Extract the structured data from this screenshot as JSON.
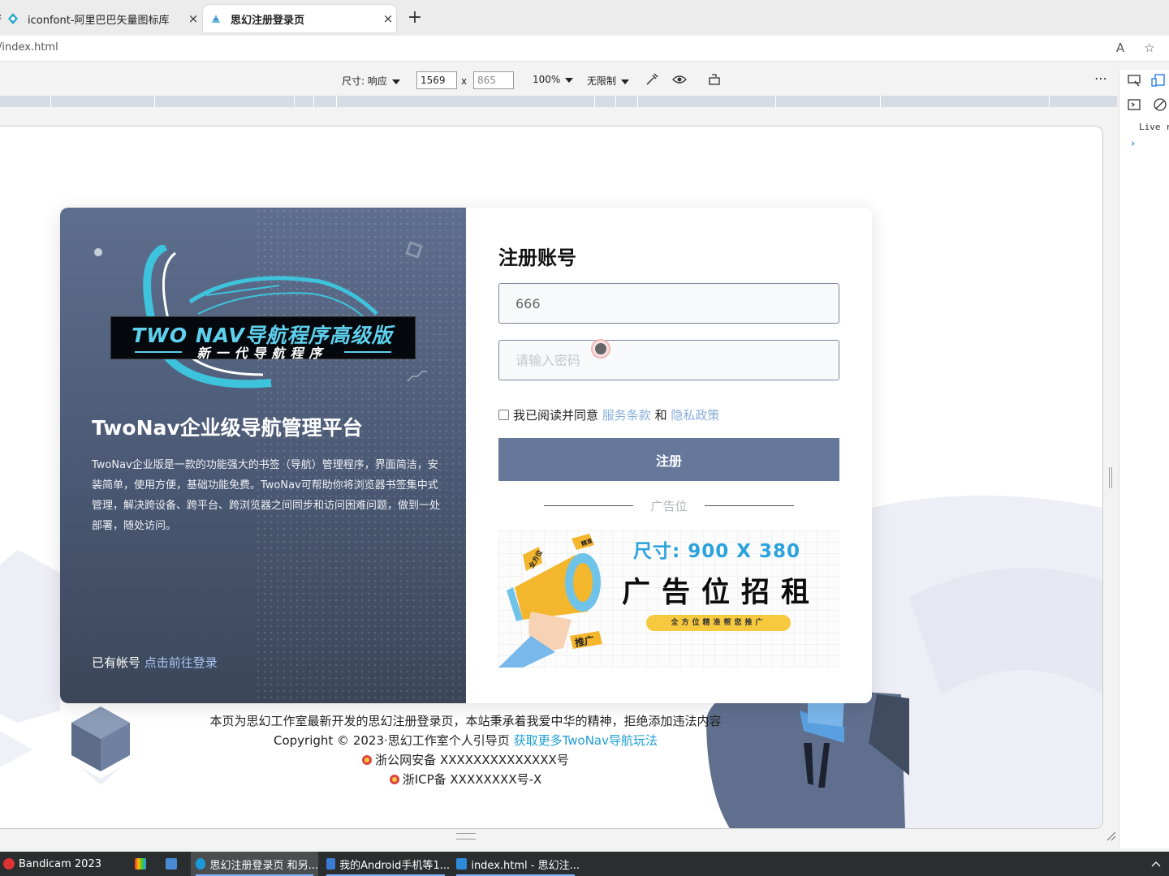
{
  "browser": {
    "tabs": [
      {
        "title": "iconfont-阿里巴巴矢量图标库",
        "icon": "iconfont-icon"
      },
      {
        "title": "思幻注册登录页",
        "icon": "page-icon"
      }
    ],
    "new_tab_label": "+",
    "close_label": "×",
    "url": "/index.html",
    "read_aloud_icon": "Aͅ",
    "favorite_icon": "☆"
  },
  "devtools": {
    "size_label": "尺寸: 响应",
    "width_value": "1569",
    "times": "x",
    "height_placeholder": "865",
    "zoom": "100%",
    "throttle": "无限制",
    "more": "⋯",
    "live_text": "Live r",
    "chevron": "›"
  },
  "page": {
    "logo": {
      "title": "TWO NAV导航程序高级版",
      "subtitle": "新一代导航程序"
    },
    "platform_title": "TwoNav企业级导航管理平台",
    "description": "TwoNav企业版是一款的功能强大的书签（导航）管理程序，界面简洁，安装简单，使用方便，基础功能免费。TwoNav可帮助你将浏览器书签集中式管理，解决跨设备、跨平台、跨浏览器之间同步和访问困难问题，做到一处部署，随处访问。",
    "have_account": "已有帐号",
    "login_link": "点击前往登录",
    "register_title": "注册账号",
    "username_value": "666",
    "password_placeholder": "请输入密码",
    "agree_text": "我已阅读并同意",
    "terms_link": "服务条款",
    "and": "和",
    "privacy_link": "隐私政策",
    "register_button": "注册",
    "ad_label": "广告位",
    "ad": {
      "size": "尺寸: 900 X 380",
      "headline": "广告位招租",
      "tagline": "全方位精准帮您推广",
      "tag1": "全方位",
      "tag2": "精准",
      "tag3": "推广"
    },
    "footer": {
      "line1": "本页为思幻工作室最新开发的思幻注册登录页，本站秉承着我爱中华的精神，拒绝添加违法内容",
      "line2_prefix": "Copyright © 2023·思幻工作室个人引导页",
      "line2_link": "获取更多TwoNav导航玩法",
      "line3": "浙公网安备 XXXXXXXXXXXXXX号",
      "line4": "浙ICP备 XXXXXXXX号-X"
    },
    "colors": {
      "left_panel": "#5e6e8d",
      "button": "#66789a",
      "link": "#8aaedb",
      "accent": "#5fd0ee"
    }
  },
  "taskbar": [
    {
      "label": "Bandicam 2023",
      "color": "#d33"
    },
    {
      "label": "",
      "color": "#e8a"
    },
    {
      "label": "",
      "color": "#4a8bd6"
    },
    {
      "label": "思幻注册登录页 和另...",
      "color": "#1b9ad8"
    },
    {
      "label": "我的Android手机等1...",
      "color": "#3a7bd5"
    },
    {
      "label": "index.html - 思幻注...",
      "color": "#2c8ad8"
    }
  ]
}
